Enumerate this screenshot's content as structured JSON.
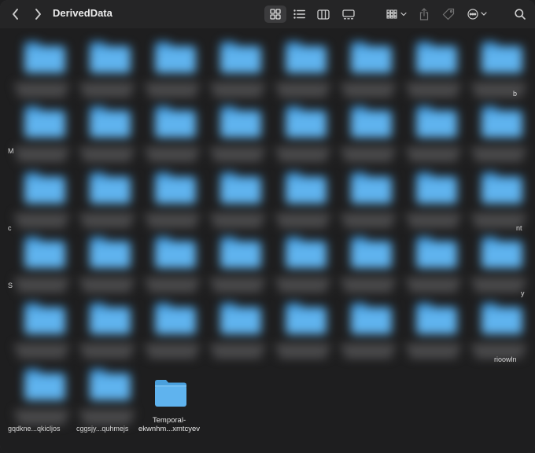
{
  "window": {
    "title": "DerivedData"
  },
  "toolbar": {
    "back_icon": "chevron-left-icon",
    "forward_icon": "chevron-right-icon",
    "view_modes": [
      "icon-view-icon",
      "list-view-icon",
      "column-view-icon",
      "gallery-view-icon"
    ],
    "active_view": "icon-view-icon",
    "group_icon": "group-by-icon",
    "share_icon": "share-icon",
    "tag_icon": "tag-icon",
    "more_icon": "ellipsis-circle-icon",
    "search_icon": "magnifier-icon"
  },
  "colors": {
    "folder_blue": "#5fb3ee",
    "background": "#1e1e1f",
    "text": "#e8e8e8"
  },
  "visible_item": {
    "label_line1": "Temporal-",
    "label_line2": "ekwnhm...xmtcyev"
  },
  "partially_visible_text": {
    "r1_right": "b",
    "r2_left": "M",
    "r3_left": "c",
    "r3_right": "nt",
    "r4_left": "S",
    "r4_right": "y",
    "r5_right": "rioowln",
    "r6_c1": "gqdkne...qkicljos",
    "r6_c2": "cggsjy...quhmejs"
  }
}
